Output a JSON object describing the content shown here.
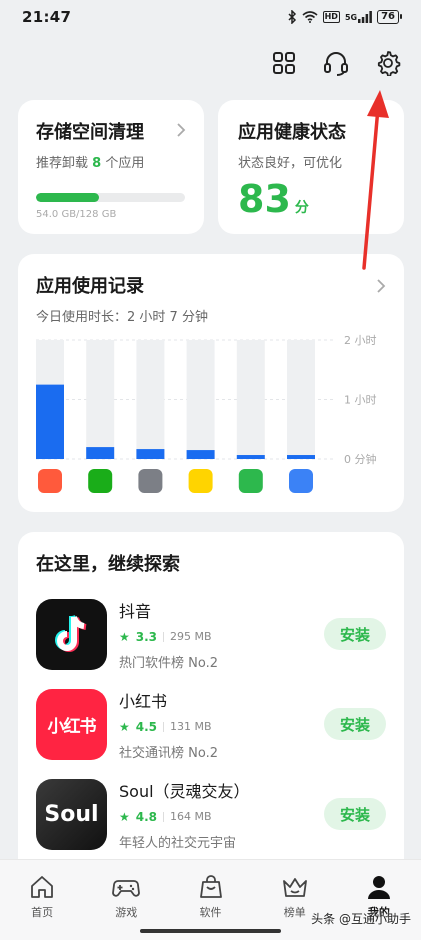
{
  "status_bar": {
    "time": "21:47",
    "battery": "76",
    "network": "5G",
    "hd": "HD"
  },
  "storage_card": {
    "title": "存储空间清理",
    "subtitle_prefix": "推荐卸载",
    "subtitle_count": "8",
    "subtitle_suffix": "个应用",
    "used_fraction": 0.42,
    "size_text": "54.0 GB/128 GB"
  },
  "health_card": {
    "title": "应用健康状态",
    "subtitle": "状态良好，可优化",
    "score": "83",
    "score_unit": "分"
  },
  "usage_card": {
    "title": "应用使用记录",
    "subtitle": "今日使用时长：2 小时 7 分钟",
    "axis_labels": [
      "2 小时",
      "1 小时",
      "0 分钟"
    ]
  },
  "chart_data": {
    "type": "bar",
    "categories": [
      "app1",
      "app2",
      "app3",
      "app4",
      "app5",
      "app6"
    ],
    "values": [
      75,
      12,
      10,
      9,
      4,
      4
    ],
    "ylim": [
      0,
      120
    ],
    "yticks": [
      "2 小时",
      "1 小时",
      "0 分钟"
    ],
    "color": "#1a6cf0",
    "track_color": "#eef0f2"
  },
  "explore_card": {
    "title": "在这里，继续探索",
    "apps": [
      {
        "name": "抖音",
        "rating": "3.3",
        "size": "295 MB",
        "desc": "热门软件榜 No.2",
        "action": "安装",
        "icon": "douyin-icon"
      },
      {
        "name": "小红书",
        "rating": "4.5",
        "size": "131 MB",
        "desc": "社交通讯榜 No.2",
        "action": "安装",
        "icon": "xiaohongshu-icon",
        "icon_text": "小红书"
      },
      {
        "name": "Soul（灵魂交友）",
        "rating": "4.8",
        "size": "164 MB",
        "desc": "年轻人的社交元宇宙",
        "action": "安装",
        "icon": "soul-icon",
        "icon_text": "Soul"
      }
    ]
  },
  "bottom_nav": {
    "items": [
      {
        "label": "首页",
        "icon": "home-icon"
      },
      {
        "label": "游戏",
        "icon": "gamepad-icon"
      },
      {
        "label": "软件",
        "icon": "bag-icon"
      },
      {
        "label": "榜单",
        "icon": "crown-icon"
      },
      {
        "label": "我的",
        "icon": "person-icon",
        "active": true
      }
    ]
  },
  "watermark": "头条 @互通小助手",
  "colors": {
    "accent": "#2db84d",
    "bar": "#1a6cf0",
    "arrow": "#e8302a"
  }
}
